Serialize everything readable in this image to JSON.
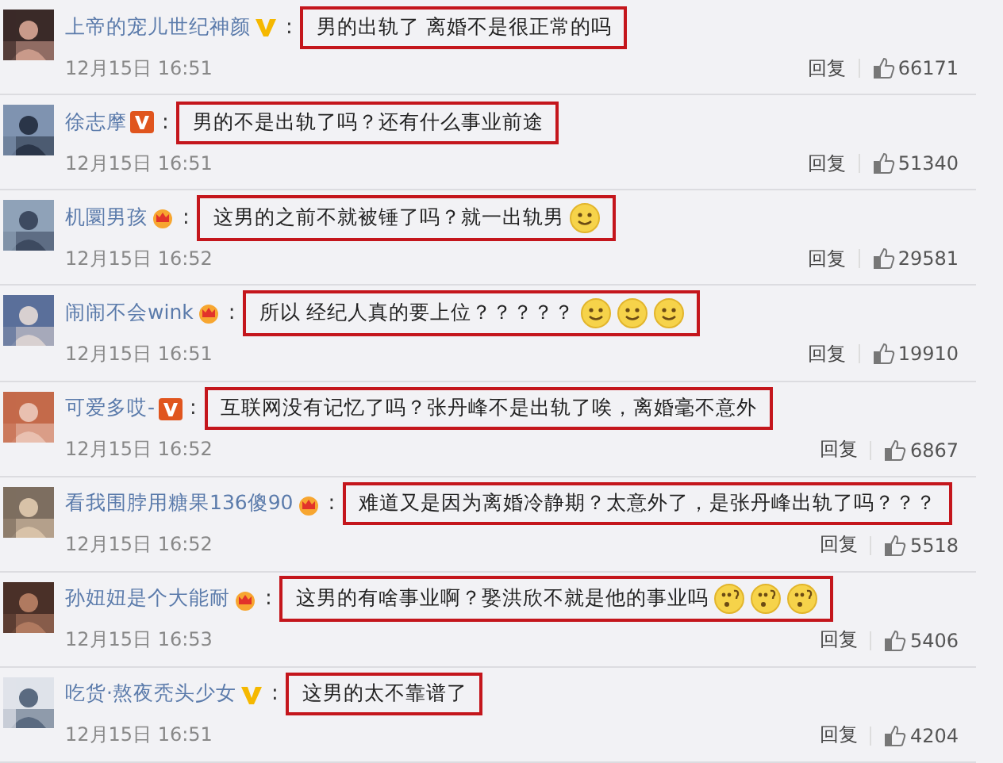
{
  "comments": [
    {
      "user": "上帝的宠儿世纪神颜",
      "badge": {
        "kind": "vip-yellow"
      },
      "separator": ":",
      "text": "男的出轨了 离婚不是很正常的吗",
      "highlighted": true,
      "time": "12月15日 16:51",
      "reply": "回复",
      "likes": "66171"
    },
    {
      "user": "徐志摩",
      "badge": {
        "kind": "vip-orange"
      },
      "separator": ":",
      "text": "男的不是出轨了吗？还有什么事业前途",
      "highlighted": true,
      "time": "12月15日 16:51",
      "reply": "回复",
      "likes": "51340"
    },
    {
      "user": "机圜男孩",
      "badge": {
        "kind": "crown"
      },
      "separator": ":",
      "text": "这男的之前不就被锤了吗？就一出轨男",
      "highlighted": true,
      "emojis": [
        {
          "kind": "smile"
        }
      ],
      "time": "12月15日 16:52",
      "reply": "回复",
      "likes": "29581"
    },
    {
      "user": "闹闹不会wink",
      "badge": {
        "kind": "crown"
      },
      "separator": ":",
      "text": "所以 经纪人真的要上位？？？？？",
      "highlighted": true,
      "emojis": [
        {
          "kind": "smile"
        },
        {
          "kind": "smile"
        },
        {
          "kind": "smile"
        }
      ],
      "time": "12月15日 16:51",
      "reply": "回复",
      "likes": "19910"
    },
    {
      "user": "可爱多哎-",
      "badge": {
        "kind": "vip-orange"
      },
      "separator": ":",
      "text": "互联网没有记忆了吗？张丹峰不是出轨了唉，离婚毫不意外",
      "highlighted": true,
      "time": "12月15日 16:52",
      "reply": "回复",
      "likes": "6867"
    },
    {
      "user": "看我围脖用糖果136傻90",
      "badge": {
        "kind": "crown"
      },
      "separator": ":",
      "text": "难道又是因为离婚冷静期？太意外了，是张丹峰出轨了吗？？？",
      "highlighted": true,
      "time": "12月15日 16:52",
      "reply": "回复",
      "likes": "5518"
    },
    {
      "user": "孙妞妞是个大能耐",
      "badge": {
        "kind": "crown"
      },
      "separator": ":",
      "text": "这男的有啥事业啊？娶洪欣不就是他的事业吗",
      "highlighted": true,
      "emojis": [
        {
          "kind": "confused"
        },
        {
          "kind": "confused"
        },
        {
          "kind": "confused"
        }
      ],
      "time": "12月15日 16:53",
      "reply": "回复",
      "likes": "5406"
    },
    {
      "user": "吃货·熬夜秃头少女",
      "badge": {
        "kind": "vip-yellow"
      },
      "separator": ":",
      "text": "这男的太不靠谱了",
      "highlighted": true,
      "time": "12月15日 16:51",
      "reply": "回复",
      "likes": "4204"
    }
  ]
}
